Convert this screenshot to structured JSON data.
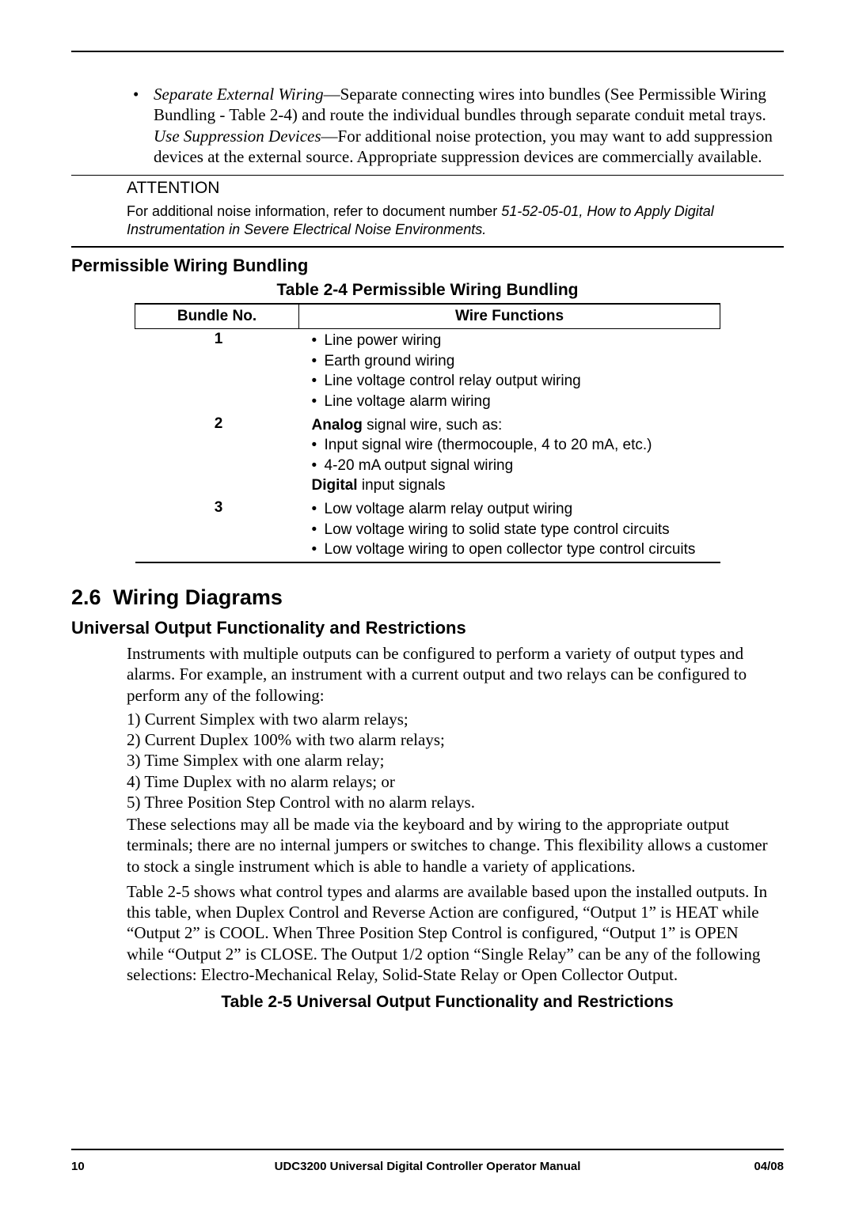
{
  "bullets": {
    "sew_label": "Separate External Wiring",
    "sew_text": "—Separate connecting wires into bundles (See Permissible Wiring Bundling - Table 2-4) and route the individual bundles through separate conduit metal trays.",
    "usd_label": "Use Suppression Devices",
    "usd_text": "—For additional noise protection, you may want to add suppression devices at the external source. Appropriate suppression devices are commercially available."
  },
  "attention": {
    "label": "ATTENTION",
    "text_prefix": "For additional noise information, refer to document number ",
    "doc_ref": "51-52-05-01, How to Apply Digital Instrumentation in Severe Electrical Noise Environments."
  },
  "pwb": {
    "heading": "Permissible Wiring Bundling",
    "caption": "Table 2-4  Permissible Wiring Bundling",
    "col1": "Bundle No.",
    "col2": "Wire Functions",
    "row1_num": "1",
    "row1_items": [
      "Line power wiring",
      "Earth ground wiring",
      "Line voltage control relay output wiring",
      "Line voltage alarm wiring"
    ],
    "row2_num": "2",
    "row2_intro_bold": "Analog",
    "row2_intro_rest": " signal wire, such as:",
    "row2_items": [
      "Input signal wire (thermocouple, 4 to 20 mA, etc.)",
      "4-20 mA output signal wiring"
    ],
    "row2_outro_bold": "Digital",
    "row2_outro_rest": " input signals",
    "row3_num": "3",
    "row3_items": [
      "Low voltage alarm relay output wiring",
      "Low voltage wiring to solid state type control circuits",
      "Low voltage wiring to open collector type control circuits"
    ]
  },
  "section": {
    "num": "2.6",
    "title": "Wiring Diagrams",
    "sub1": "Universal Output Functionality and Restrictions",
    "para1": "Instruments with multiple outputs can be configured to perform a variety of output types and alarms.  For example, an instrument with a current output and two relays can be configured to perform any of the following:",
    "opt1": "1) Current Simplex with two alarm relays;",
    "opt2": "2) Current Duplex 100% with two alarm relays;",
    "opt3": "3) Time Simplex with one alarm relay;",
    "opt4": "4) Time Duplex with no alarm relays; or",
    "opt5": "5) Three Position Step Control with no alarm relays.",
    "para2": "These selections may all be made via the keyboard and by wiring to the appropriate output terminals; there are no internal jumpers or switches to change.  This flexibility allows a customer to stock a single instrument which is able to handle a variety of applications.",
    "para3": "Table 2-5 shows what control types and alarms are available based upon the installed outputs.  In this table, when Duplex Control and Reverse Action are configured, “Output 1” is HEAT while “Output 2” is COOL.  When Three Position Step Control is configured, “Output 1” is OPEN while “Output 2” is CLOSE.  The Output 1/2 option “Single Relay” can be any of the following selections: Electro-Mechanical Relay, Solid-State Relay or Open Collector Output.",
    "table25_caption": "Table 2-5 Universal Output Functionality and Restrictions"
  },
  "footer": {
    "page": "10",
    "title": "UDC3200 Universal Digital Controller Operator Manual",
    "date": "04/08"
  }
}
